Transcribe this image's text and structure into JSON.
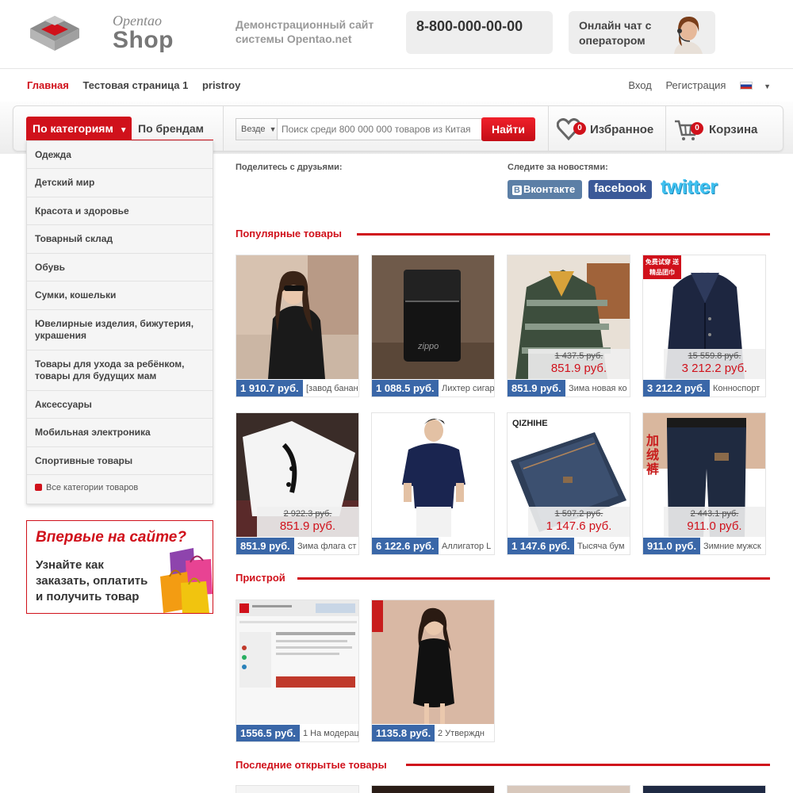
{
  "header": {
    "logo_top": "Opentao",
    "logo_bottom": "Shop",
    "tagline": "Демонстрационный сайт системы Opentao.net",
    "phone": "8-800-000-00-00",
    "chat": "Онлайн чат с оператором"
  },
  "topnav": {
    "items": [
      "Главная",
      "Тестовая страница 1",
      "pristroy"
    ],
    "login": "Вход",
    "register": "Регистрация"
  },
  "searchbar": {
    "tab_categories": "По категориям",
    "tab_brands": "По брендам",
    "scope": "Везде",
    "placeholder": "Поиск среди 800 000 000 товаров из Китая",
    "search_button": "Найти",
    "favorites_label": "Избранное",
    "favorites_count": "0",
    "cart_label": "Корзина",
    "cart_count": "0"
  },
  "categories": {
    "items": [
      "Одежда",
      "Детский мир",
      "Красота и здоровье",
      "Товарный склад",
      "Обувь",
      "Сумки, кошельки",
      "Ювелирные изделия, бижутерия, украшения",
      "Товары для ухода за ребёнком, товары для будущих мам",
      "Аксессуары",
      "Мобильная электроника",
      "Спортивные товары"
    ],
    "all": "Все категории товаров"
  },
  "promo": {
    "title": "Впервые на сайте?",
    "text": "Узнайте как заказать, оплатить и получить товар"
  },
  "social": {
    "share_label": "Поделитесь с друзьями:",
    "news_label": "Следите за новостями:",
    "vk": "Вконтакте",
    "facebook": "facebook",
    "twitter": "twitter"
  },
  "sections": {
    "popular": "Популярные товары",
    "pristroy": "Пристрой",
    "recent": "Последние открытые товары"
  },
  "popular_products": [
    {
      "price": "1 910.7 руб.",
      "name": "[завод банан",
      "old": "",
      "new": ""
    },
    {
      "price": "1 088.5 руб.",
      "name": "Лихтер сигарет",
      "old": "",
      "new": ""
    },
    {
      "price": "851.9 руб.",
      "name": "Зима новая ко",
      "old": "1 437.5 руб.",
      "new": "851.9 руб."
    },
    {
      "price": "3 212.2 руб.",
      "name": "Конноспорт",
      "old": "15 559.8 руб.",
      "new": "3 212.2 руб.",
      "badge": "免费试穿 送精品团巾"
    },
    {
      "price": "851.9 руб.",
      "name": "Зима флага ст",
      "old": "2 922.3 руб.",
      "new": "851.9 руб."
    },
    {
      "price": "6 122.6 руб.",
      "name": "Аллигатор L",
      "old": "",
      "new": ""
    },
    {
      "price": "1 147.6 руб.",
      "name": "Тысяча бум",
      "old": "1 597.2 руб.",
      "new": "1 147.6 руб.",
      "brand": "QIZHIHE"
    },
    {
      "price": "911.0 руб.",
      "name": "Зимние мужск",
      "old": "2 443.1 руб.",
      "new": "911.0 руб."
    }
  ],
  "pristroy_products": [
    {
      "price": "1556.5 руб.",
      "name": "1 На модерац"
    },
    {
      "price": "1135.8 руб.",
      "name": "2 Утверждн"
    }
  ],
  "colors": {
    "accent": "#d0111b",
    "price_bg": "#3a67a8"
  }
}
